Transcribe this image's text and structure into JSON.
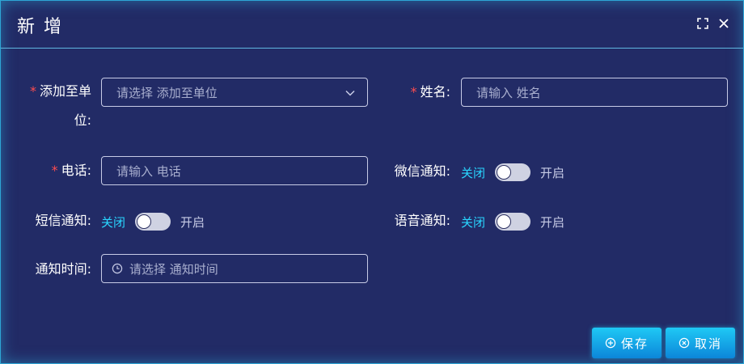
{
  "dialog": {
    "title": "新 增"
  },
  "form": {
    "unit": {
      "required_mark": "*",
      "label_line1": "添加至单",
      "label_line2": "位:",
      "placeholder": "请选择 添加至单位"
    },
    "name": {
      "required_mark": "*",
      "label": "姓名:",
      "placeholder": "请输入 姓名"
    },
    "phone": {
      "required_mark": "*",
      "label": "电话:",
      "placeholder": "请输入 电话"
    },
    "wechat_notice": {
      "label": "微信通知:",
      "off_text": "关闭",
      "on_text": "开启",
      "enabled": false
    },
    "sms_notice": {
      "label": "短信通知:",
      "off_text": "关闭",
      "on_text": "开启",
      "enabled": false
    },
    "voice_notice": {
      "label": "语音通知:",
      "off_text": "关闭",
      "on_text": "开启",
      "enabled": false
    },
    "notice_time": {
      "label": "通知时间:",
      "placeholder": "请选择 通知时间"
    }
  },
  "buttons": {
    "save_label": "保存",
    "cancel_label": "取消"
  },
  "colors": {
    "background": "#222b66",
    "accent": "#29d6ff",
    "required": "#ff4d4f"
  }
}
